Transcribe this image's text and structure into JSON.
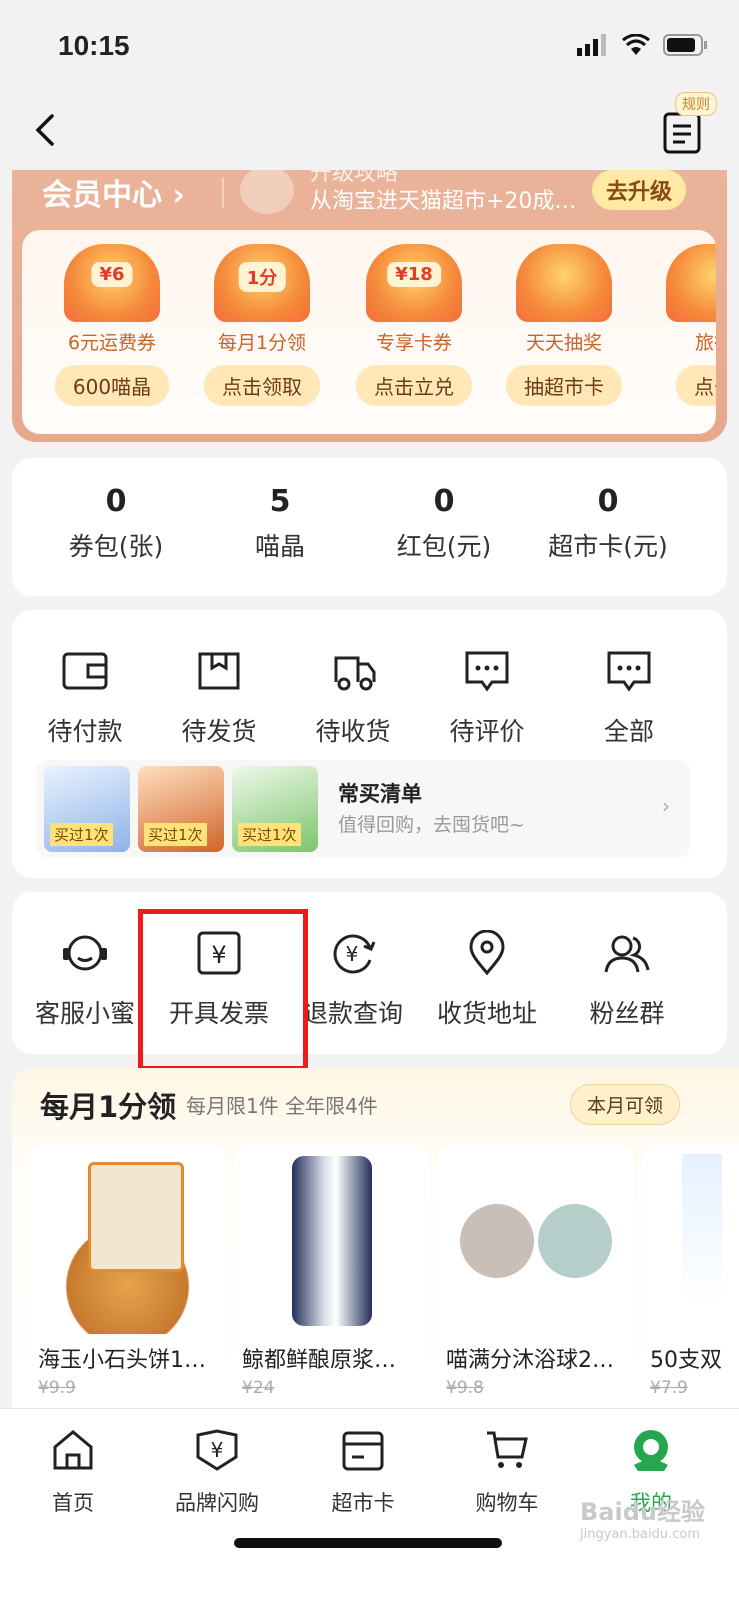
{
  "status_bar": {
    "time": "10:15"
  },
  "nav": {
    "rule_badge": "规则"
  },
  "member": {
    "title": "会员中心",
    "upgrade_tip_line1": "升级攻略",
    "upgrade_tip_line2": "从淘宝进天猫超市+20成…",
    "upgrade_button": "去升级",
    "benefits": [
      {
        "badge": "¥6",
        "name": "6元运费券",
        "action": "600喵晶"
      },
      {
        "badge": "1分",
        "name": "每月1分领",
        "action": "点击领取"
      },
      {
        "badge": "¥18",
        "name": "专享卡券",
        "action": "点击立兑"
      },
      {
        "badge": "",
        "name": "天天抽奖",
        "action": "抽超市卡"
      },
      {
        "badge": "",
        "name": "旅行",
        "action": "点击"
      }
    ]
  },
  "stats": [
    {
      "value": "0",
      "label": "券包(张)"
    },
    {
      "value": "5",
      "label": "喵晶"
    },
    {
      "value": "0",
      "label": "红包(元)"
    },
    {
      "value": "0",
      "label": "超市卡(元)"
    }
  ],
  "orders": {
    "items": [
      "待付款",
      "待发货",
      "待收货",
      "待评价",
      "全部"
    ],
    "often_title": "常买清单",
    "often_sub": "值得回购，去囤货吧~",
    "thumb_tag": "买过1次"
  },
  "services": [
    "客服小蜜",
    "开具发票",
    "退款查询",
    "收货地址",
    "粉丝群"
  ],
  "monthly": {
    "title": "每月1分领",
    "sub": "每月限1件 全年限4件",
    "badge": "本月可领",
    "products": [
      {
        "name": "海玉小石头饼1…",
        "price": "¥9.9"
      },
      {
        "name": "鲸都鲜酿原浆…",
        "price": "¥24"
      },
      {
        "name": "喵满分沐浴球2…",
        "price": "¥9.8"
      },
      {
        "name": "50支双",
        "price": "¥7.9"
      }
    ]
  },
  "tabbar": [
    "首页",
    "品牌闪购",
    "超市卡",
    "购物车",
    "我的"
  ],
  "colors": {
    "accent_green": "#27a650",
    "highlight_red": "#ea1c1c"
  }
}
